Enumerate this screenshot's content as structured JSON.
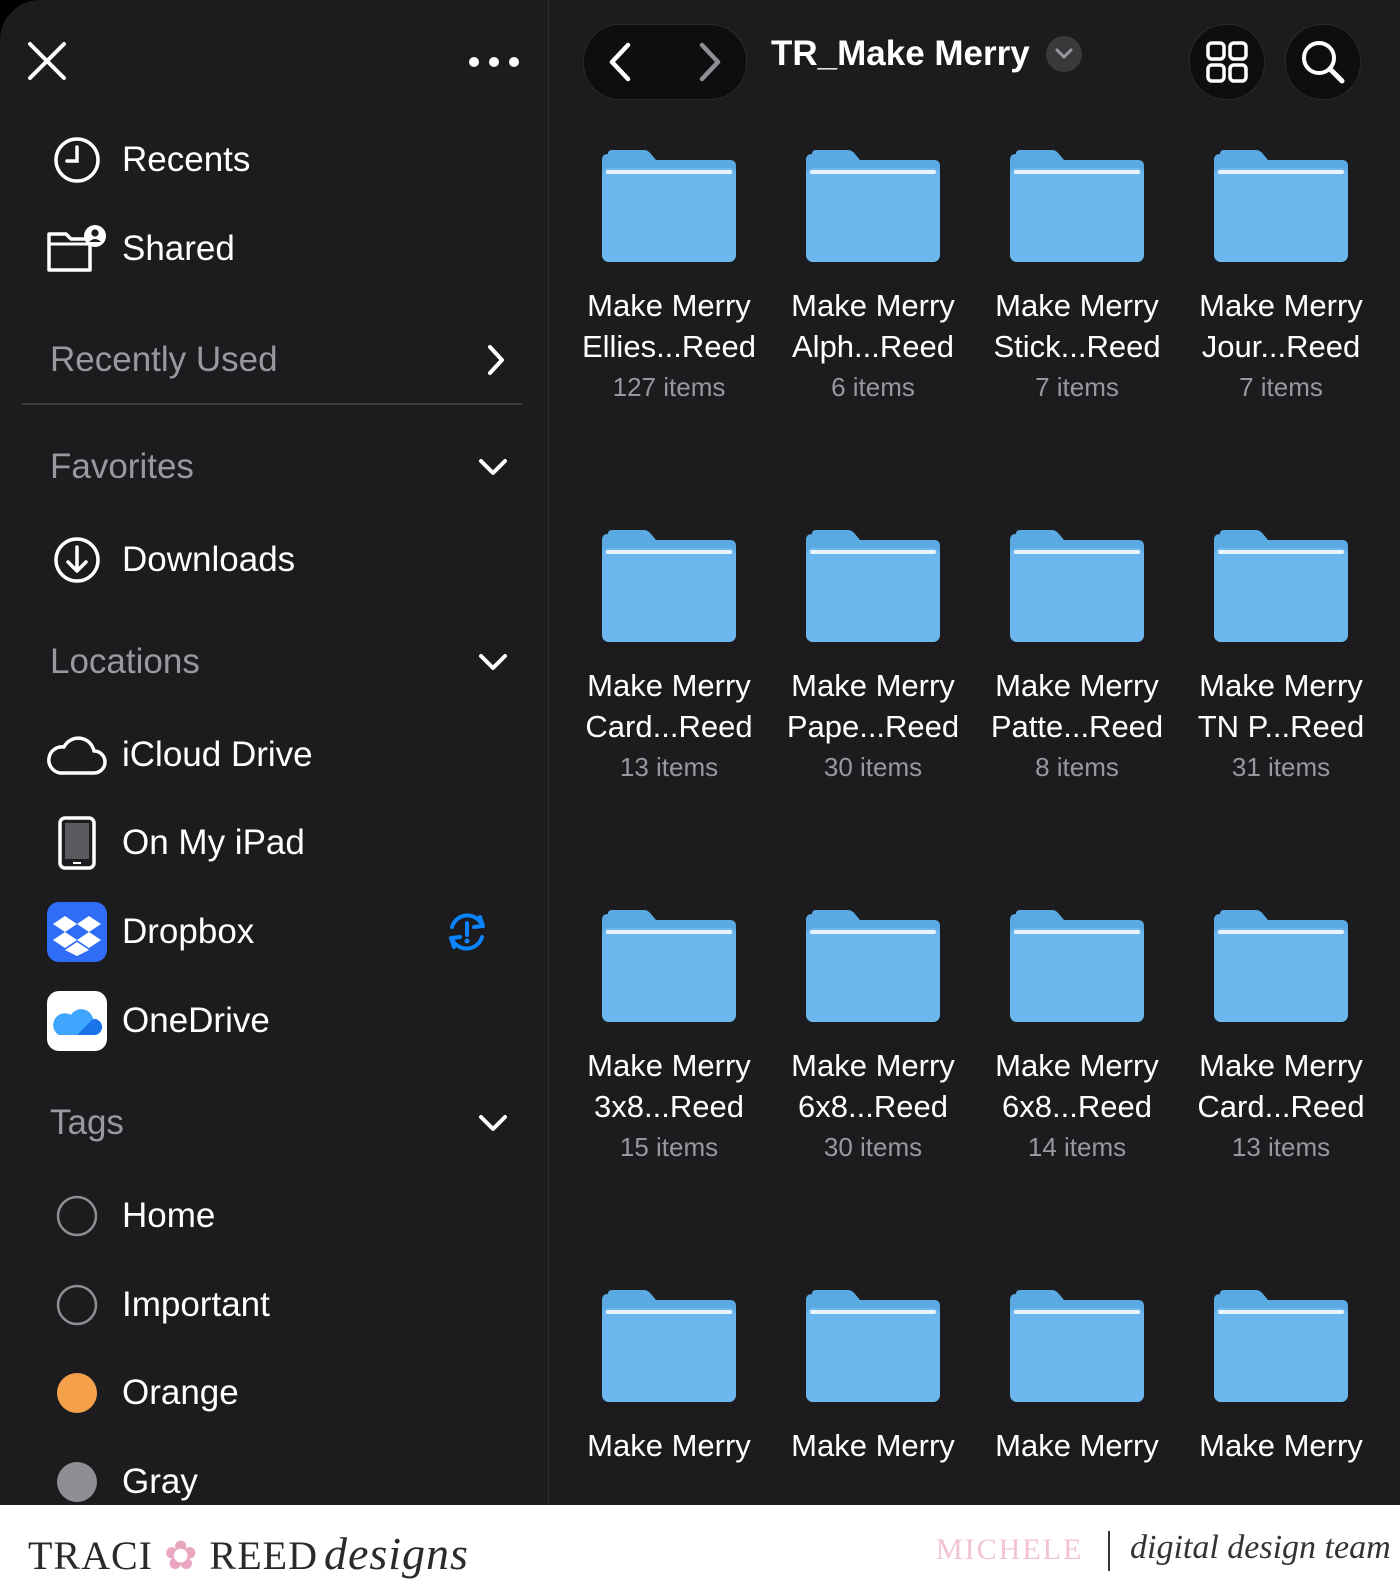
{
  "sidebar": {
    "top_items": [
      {
        "label": "Recents",
        "icon": "clock-icon"
      },
      {
        "label": "Shared",
        "icon": "shared-folder-icon"
      }
    ],
    "recently_used": {
      "label": "Recently Used",
      "icon": "chevron-right-icon"
    },
    "favorites": {
      "label": "Favorites",
      "items": [
        {
          "label": "Downloads",
          "icon": "download-icon"
        }
      ]
    },
    "locations": {
      "label": "Locations",
      "items": [
        {
          "label": "iCloud Drive",
          "icon": "cloud-icon"
        },
        {
          "label": "On My iPad",
          "icon": "ipad-icon"
        },
        {
          "label": "Dropbox",
          "icon": "dropbox-icon",
          "status_icon": "sync-alert-icon"
        },
        {
          "label": "OneDrive",
          "icon": "onedrive-icon"
        }
      ]
    },
    "tags": {
      "label": "Tags",
      "items": [
        {
          "label": "Home",
          "color": ""
        },
        {
          "label": "Important",
          "color": ""
        },
        {
          "label": "Orange",
          "color": "#f5a04a"
        },
        {
          "label": "Gray",
          "color": "#8e8e93"
        }
      ]
    }
  },
  "toolbar": {
    "title": "TR_Make Merry",
    "back_icon": "chevron-left-icon",
    "forward_icon": "chevron-right-icon",
    "view_icon": "grid-view-icon",
    "search_icon": "search-icon"
  },
  "folders": [
    {
      "line1": "Make Merry",
      "line2": "Ellies...Reed",
      "count": "127 items"
    },
    {
      "line1": "Make Merry",
      "line2": "Alph...Reed",
      "count": "6 items"
    },
    {
      "line1": "Make Merry",
      "line2": "Stick...Reed",
      "count": "7 items"
    },
    {
      "line1": "Make Merry",
      "line2": "Jour...Reed",
      "count": "7 items"
    },
    {
      "line1": "Make Merry",
      "line2": "Card...Reed",
      "count": "13 items"
    },
    {
      "line1": "Make Merry",
      "line2": "Pape...Reed",
      "count": "30 items"
    },
    {
      "line1": "Make Merry",
      "line2": "Patte...Reed",
      "count": "8 items"
    },
    {
      "line1": "Make Merry",
      "line2": "TN P...Reed",
      "count": "31 items"
    },
    {
      "line1": "Make Merry",
      "line2": "3x8...Reed",
      "count": "15 items"
    },
    {
      "line1": "Make Merry",
      "line2": "6x8...Reed",
      "count": "30 items"
    },
    {
      "line1": "Make Merry",
      "line2": "6x8...Reed",
      "count": "14 items"
    },
    {
      "line1": "Make Merry",
      "line2": "Card...Reed",
      "count": "13 items"
    },
    {
      "line1": "Make Merry",
      "line2": "",
      "count": ""
    },
    {
      "line1": "Make Merry",
      "line2": "",
      "count": ""
    },
    {
      "line1": "Make Merry",
      "line2": "",
      "count": ""
    },
    {
      "line1": "Make Merry",
      "line2": "",
      "count": ""
    }
  ],
  "footer": {
    "brand_left": "TRACI",
    "brand_right": "REED",
    "brand_script": "designs",
    "designer": "MICHELE",
    "team": "digital design team"
  },
  "colors": {
    "accent": "#0a84ff",
    "folder": "#6cb4ea",
    "background": "#1c1c1e"
  }
}
